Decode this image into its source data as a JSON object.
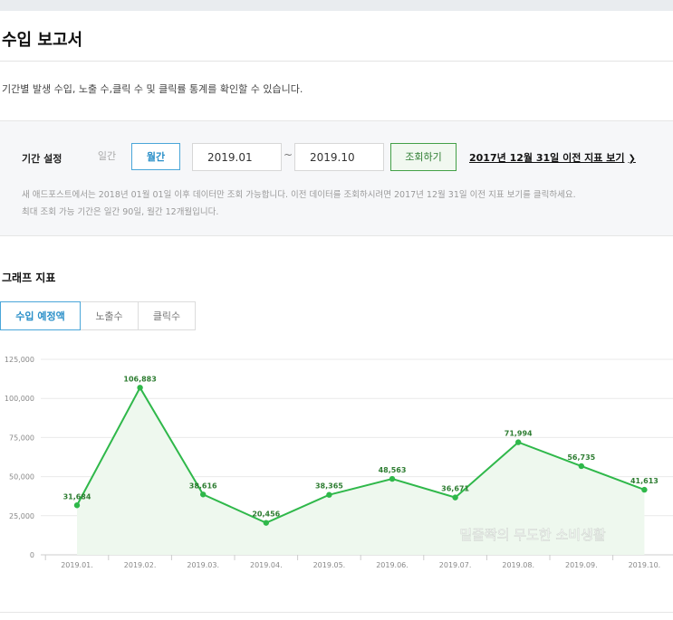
{
  "page": {
    "title": "수입 보고서",
    "description": "기간별 발생 수입, 노출 수,클릭 수 및 클릭률 통계를 확인할 수 있습니다."
  },
  "filter": {
    "label": "기간 설정",
    "daily": "일간",
    "monthly": "월간",
    "from": "2019.01",
    "tilde": "~",
    "to": "2019.10",
    "search_button": "조회하기",
    "old_report_link": "2017년 12월 31일 이전 지표 보기",
    "note1": "새 애드포스트에서는 2018년 01월 01일 이후 데이터만 조회 가능합니다. 이전 데이터를 조회하시려면 2017년 12월 31일 이전 지표 보기를 클릭하세요.",
    "note2": "최대 조회 가능 기간은 일간 90일, 월간 12개월입니다."
  },
  "graph": {
    "section_title": "그래프 지표",
    "tabs": [
      "수입 예정액",
      "노출수",
      "클릭수"
    ],
    "watermark": "밑줄쫙의 무도한 소비생활"
  },
  "colors": {
    "line": "#2fb84a",
    "area": "#eef8ee",
    "accent_blue": "#2a8fc8"
  },
  "chart_data": {
    "type": "line",
    "categories": [
      "2019.01.",
      "2019.02.",
      "2019.03.",
      "2019.04.",
      "2019.05.",
      "2019.06.",
      "2019.07.",
      "2019.08.",
      "2019.09.",
      "2019.10."
    ],
    "values": [
      31684,
      106883,
      38616,
      20456,
      38365,
      48563,
      36671,
      71994,
      56735,
      41613
    ],
    "value_labels": [
      "31,684",
      "106,883",
      "38,616",
      "20,456",
      "38,365",
      "48,563",
      "36,671",
      "71,994",
      "56,735",
      "41,613"
    ],
    "y_ticks": [
      "0",
      "25,000",
      "50,000",
      "75,000",
      "100,000",
      "125,000"
    ],
    "ylim": [
      0,
      125000
    ],
    "grid": true
  }
}
